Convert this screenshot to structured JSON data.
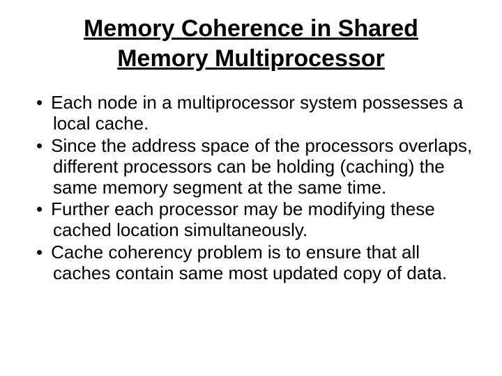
{
  "title": "Memory Coherence in Shared Memory Multiprocessor",
  "bullets": [
    "Each node in a multiprocessor system possesses a local cache.",
    "Since the address space of the processors overlaps, different processors can be holding (caching) the same memory segment at the same time.",
    "Further each processor may be modifying these cached location simultaneously.",
    "Cache coherency problem is to ensure that all caches contain same most updated copy of data."
  ]
}
